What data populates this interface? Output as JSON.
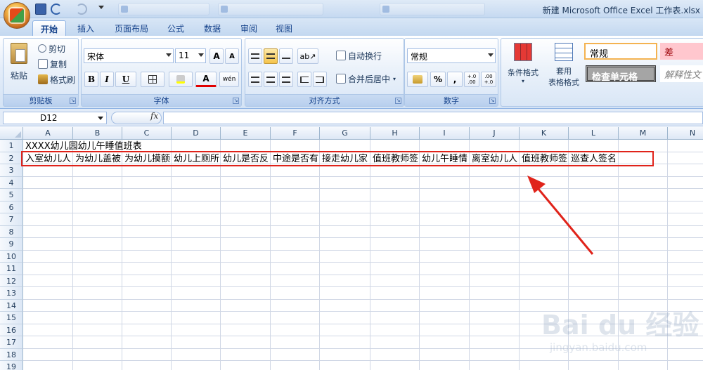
{
  "window": {
    "title": "新建 Microsoft Office Excel 工作表.xlsx"
  },
  "taskbar_tabs": [
    "",
    ""
  ],
  "ribbon_tabs": [
    "开始",
    "插入",
    "页面布局",
    "公式",
    "数据",
    "审阅",
    "视图"
  ],
  "clipboard": {
    "paste": "粘贴",
    "cut": "剪切",
    "copy": "复制",
    "format_painter": "格式刷",
    "label": "剪贴板"
  },
  "font": {
    "name": "宋体",
    "size": "11",
    "label": "字体",
    "bold": "B",
    "italic": "I",
    "underline": "U",
    "grow": "A",
    "shrink": "A",
    "color": "A",
    "phonetic": "wén"
  },
  "alignment": {
    "wrap": "自动换行",
    "merge": "合并后居中",
    "label": "对齐方式"
  },
  "number": {
    "format": "常规",
    "percent": "%",
    "comma": ",",
    "inc_decimal": "+.0 .00",
    "dec_decimal": ".00 +.0",
    "label": "数字"
  },
  "styles": {
    "conditional": "条件格式",
    "table_format_1": "套用",
    "table_format_2": "表格格式",
    "normal": "常规",
    "bad": "差",
    "check_cell": "检查单元格",
    "explanatory": "解释性文"
  },
  "formula_bar": {
    "name_box": "D12",
    "fx": "fx",
    "value": ""
  },
  "columns": [
    "A",
    "B",
    "C",
    "D",
    "E",
    "F",
    "G",
    "H",
    "I",
    "J",
    "K",
    "L",
    "M",
    "N"
  ],
  "rows": [
    "1",
    "2",
    "3",
    "4",
    "5",
    "6",
    "7",
    "8",
    "9",
    "10",
    "11",
    "12",
    "13",
    "14",
    "15",
    "16",
    "17",
    "18",
    "19"
  ],
  "cells": {
    "A1": "XXXX幼儿园幼儿午睡值班表",
    "row2": [
      "入室幼儿人",
      "为幼儿盖被",
      "为幼儿摸额",
      "幼儿上厕所",
      "幼儿是否反",
      "中途是否有",
      "接走幼儿家",
      "值班教师签",
      "幼儿午睡情",
      "离室幼儿人",
      "值班教师签",
      "巡查人签名"
    ]
  },
  "watermark": {
    "main": "Bai du 经验",
    "sub": "jingyan.baidu.com"
  },
  "colors": {
    "highlight": "#e0231a",
    "ribbon_text": "#15428b"
  }
}
